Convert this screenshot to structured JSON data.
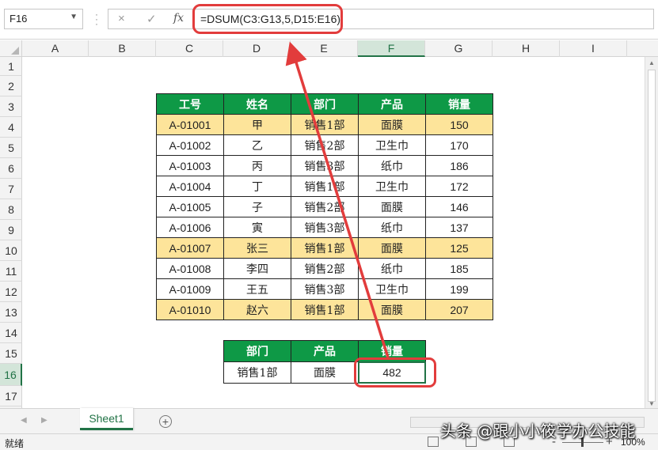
{
  "name_box": "F16",
  "formula_bar": {
    "cancel_icon": "×",
    "enter_icon": "✓",
    "fx_icon": "fx",
    "formula": "=DSUM(C3:G13,5,D15:E16)"
  },
  "columns": [
    "A",
    "B",
    "C",
    "D",
    "E",
    "F",
    "G",
    "H",
    "I"
  ],
  "rows": [
    "1",
    "2",
    "3",
    "4",
    "5",
    "6",
    "7",
    "8",
    "9",
    "10",
    "11",
    "12",
    "13",
    "14",
    "15",
    "16",
    "17"
  ],
  "selected": {
    "column": "F",
    "row": "16"
  },
  "main_table": {
    "headers": [
      "工号",
      "姓名",
      "部门",
      "产品",
      "销量"
    ],
    "rows": [
      {
        "id": "A-01001",
        "name": "甲",
        "dept": "销售1部",
        "product": "面膜",
        "qty": "150",
        "highlight": true
      },
      {
        "id": "A-01002",
        "name": "乙",
        "dept": "销售2部",
        "product": "卫生巾",
        "qty": "170",
        "highlight": false
      },
      {
        "id": "A-01003",
        "name": "丙",
        "dept": "销售3部",
        "product": "纸巾",
        "qty": "186",
        "highlight": false
      },
      {
        "id": "A-01004",
        "name": "丁",
        "dept": "销售1部",
        "product": "卫生巾",
        "qty": "172",
        "highlight": false
      },
      {
        "id": "A-01005",
        "name": "子",
        "dept": "销售2部",
        "product": "面膜",
        "qty": "146",
        "highlight": false
      },
      {
        "id": "A-01006",
        "name": "寅",
        "dept": "销售3部",
        "product": "纸巾",
        "qty": "137",
        "highlight": false
      },
      {
        "id": "A-01007",
        "name": "张三",
        "dept": "销售1部",
        "product": "面膜",
        "qty": "125",
        "highlight": true
      },
      {
        "id": "A-01008",
        "name": "李四",
        "dept": "销售2部",
        "product": "纸巾",
        "qty": "185",
        "highlight": false
      },
      {
        "id": "A-01009",
        "name": "王五",
        "dept": "销售3部",
        "product": "卫生巾",
        "qty": "199",
        "highlight": false
      },
      {
        "id": "A-01010",
        "name": "赵六",
        "dept": "销售1部",
        "product": "面膜",
        "qty": "207",
        "highlight": true
      }
    ]
  },
  "criteria_table": {
    "headers": [
      "部门",
      "产品",
      "销量"
    ],
    "values": [
      "销售1部",
      "面膜",
      "482"
    ]
  },
  "sheet_tabs": {
    "active": "Sheet1",
    "add_icon": "+"
  },
  "status_bar": {
    "ready": "就绪",
    "zoom": "100%",
    "zoom_minus": "-",
    "zoom_plus": "+"
  },
  "watermark": "头条 @跟小小筱学办公技能",
  "colors": {
    "header_green": "#0e9946",
    "highlight_yellow": "#fde49a",
    "annotation_red": "#e23c3c",
    "excel_green": "#217346"
  }
}
